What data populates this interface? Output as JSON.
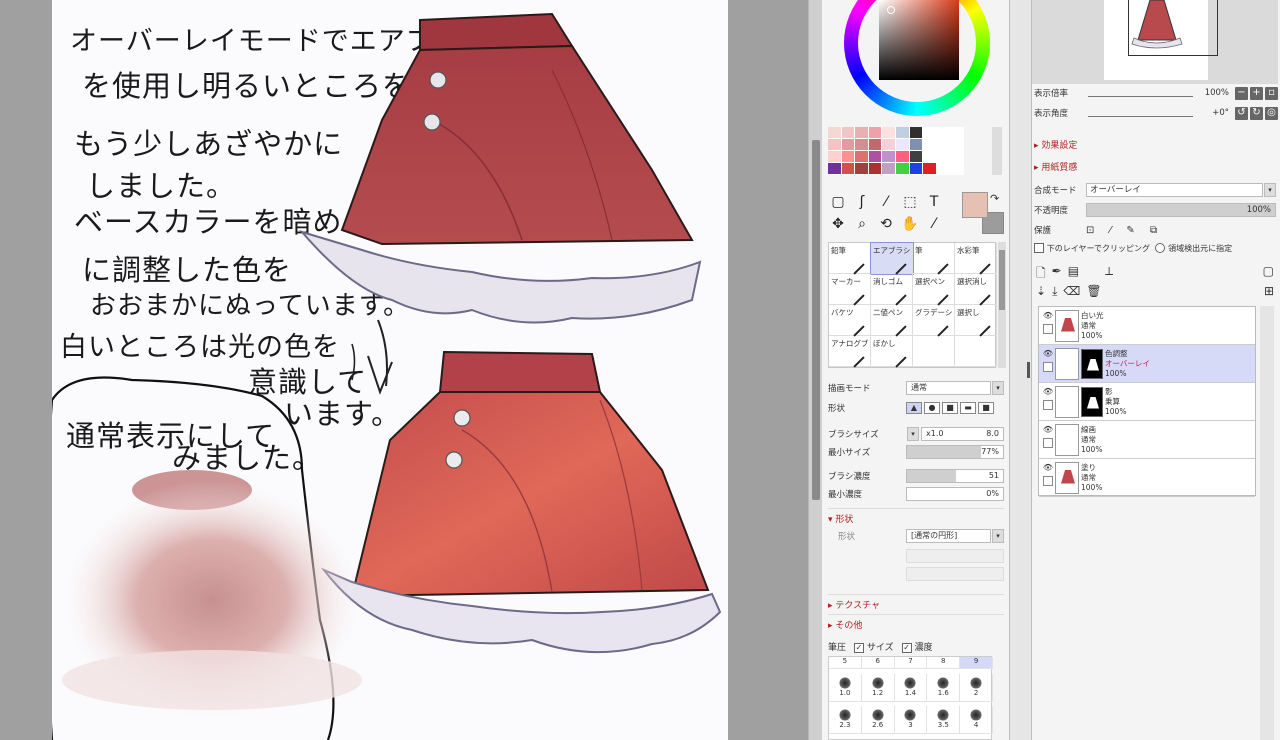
{
  "canvas": {
    "note_lines": [
      "オーバーレイモードでエアブラシ",
      "を使用し明るいところを",
      "もう少しあざやかに",
      "しました。",
      "ベースカラーを暗め",
      "に調整した色を",
      "おおまかにぬっています。",
      "白いところは光の色を",
      "意識して",
      "います。"
    ],
    "normal_view_lines": [
      "通常表示にして",
      "みました。"
    ],
    "skirt_colors": {
      "top": "#b5494d",
      "bottom": "#c85a52",
      "frill": "#e9e6ee",
      "outline": "#2a1a1a"
    }
  },
  "tool_panel": {
    "swatches": [
      "#f6d8d2",
      "#efc6c6",
      "#e8b0b0",
      "#f0a0a8",
      "#ffe0e0",
      "#c0d0e0",
      "#303030",
      "#fff",
      "#fff",
      "#fff",
      "#f4c4c4",
      "#e49aa0",
      "#d88c90",
      "#c06a70",
      "#f4d0d8",
      "#e8e8ff",
      "#8090b0",
      "#fff",
      "#fff",
      "#fff",
      "#ffd0d0",
      "#ff9090",
      "#e07070",
      "#b050a0",
      "#c090d0",
      "#ff6080",
      "#404040",
      "#fff",
      "#fff",
      "#fff",
      "#7030a0",
      "#d05050",
      "#a04040",
      "#b03030",
      "#c0a0c0",
      "#40d040",
      "#2040e0",
      "#e02020",
      "#fff",
      "#fff"
    ],
    "tool_icons_row1": [
      "▢",
      "ʃ",
      "⁄",
      "⬚",
      "T"
    ],
    "tool_icons_row2": [
      "✥",
      "⌕",
      "⟲",
      "✋",
      "⁄"
    ],
    "brushes": [
      {
        "label": "鉛筆",
        "selected": false
      },
      {
        "label": "エアブラシ",
        "selected": true
      },
      {
        "label": "筆",
        "selected": false
      },
      {
        "label": "水彩筆",
        "selected": false
      },
      {
        "label": "マーカー",
        "selected": false
      },
      {
        "label": "消しゴム",
        "selected": false
      },
      {
        "label": "選択ペン",
        "selected": false
      },
      {
        "label": "選択消し",
        "selected": false
      },
      {
        "label": "バケツ",
        "selected": false
      },
      {
        "label": "二値ペン",
        "selected": false
      },
      {
        "label": "グラデーション",
        "selected": false
      },
      {
        "label": "選択し",
        "selected": false
      },
      {
        "label": "アナログブラシ",
        "selected": false
      },
      {
        "label": "ぼかし",
        "selected": false
      },
      {
        "label": "",
        "selected": false
      },
      {
        "label": "",
        "selected": false
      }
    ],
    "blend_mode_label": "描画モード",
    "blend_mode_value": "通常",
    "shape_label": "形状",
    "shape_options": [
      "▲",
      "●",
      "■",
      "▬",
      "■"
    ],
    "brush_size_label": "ブラシサイズ",
    "brush_size_multiplier": "x1.0",
    "brush_size_value": "8.0",
    "min_size_label": "最小サイズ",
    "min_size_value": "77%",
    "min_size_fraction": 0.77,
    "brush_density_label": "ブラシ濃度",
    "brush_density_value": "51",
    "brush_density_fraction": 0.51,
    "min_density_label": "最小濃度",
    "min_density_value": "0%",
    "section_shape": "▾ 形状",
    "shape_type_label": "形状",
    "shape_type_value": "[通常の円形]",
    "section_texture": "▸ テクスチャ",
    "section_other": "▸ その他",
    "pressure_label": "筆圧",
    "check_size": "サイズ",
    "check_density": "濃度",
    "size_headers": [
      "5",
      "6",
      "7",
      "8",
      "9"
    ],
    "size_cells": [
      "1.0",
      "1.2",
      "1.4",
      "1.6",
      "2",
      "2.3",
      "2.6",
      "3",
      "3.5",
      "4"
    ]
  },
  "layer_panel": {
    "zoom_label": "表示倍率",
    "zoom_value": "100%",
    "angle_label": "表示角度",
    "angle_value": "+0°",
    "section_effect": "▸ 効果設定",
    "section_paper": "▸ 用紙質感",
    "blend_label": "合成モード",
    "blend_value": "オーバーレイ",
    "opacity_label": "不透明度",
    "opacity_value": "100%",
    "protect_label": "保護",
    "clip_label": "下のレイヤーでクリッピング",
    "ref_label": "領域検出元に指定",
    "layers": [
      {
        "name": "白い光",
        "blend": "通常",
        "opacity": "100%",
        "selected": false,
        "mask": false
      },
      {
        "name": "色調整",
        "blend": "オーバーレイ",
        "opacity": "100%",
        "selected": true,
        "mask": true
      },
      {
        "name": "影",
        "blend": "乗算",
        "opacity": "100%",
        "selected": false,
        "mask": true
      },
      {
        "name": "線画",
        "blend": "通常",
        "opacity": "100%",
        "selected": false,
        "mask": false
      },
      {
        "name": "塗り",
        "blend": "通常",
        "opacity": "100%",
        "selected": false,
        "mask": false
      }
    ]
  }
}
